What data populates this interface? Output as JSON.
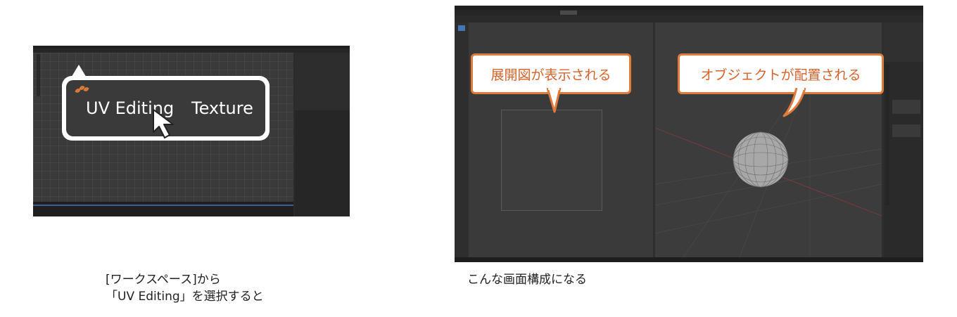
{
  "left_panel": {
    "callout": {
      "tab_active": "UV Editing",
      "tab_next": "Texture"
    },
    "caption_line1": "[ワークスペース]から",
    "caption_line2": "「UV Editing」を選択すると"
  },
  "right_panel": {
    "callout_left": "展開図が表示される",
    "callout_right": "オブジェクトが配置される",
    "caption": "こんな画面構成になる"
  },
  "colors": {
    "accent": "#e07b3a",
    "accent_text": "#d9622a",
    "blender_bg": "#2b2b2b",
    "callout_dark": "#3a3a3a"
  }
}
